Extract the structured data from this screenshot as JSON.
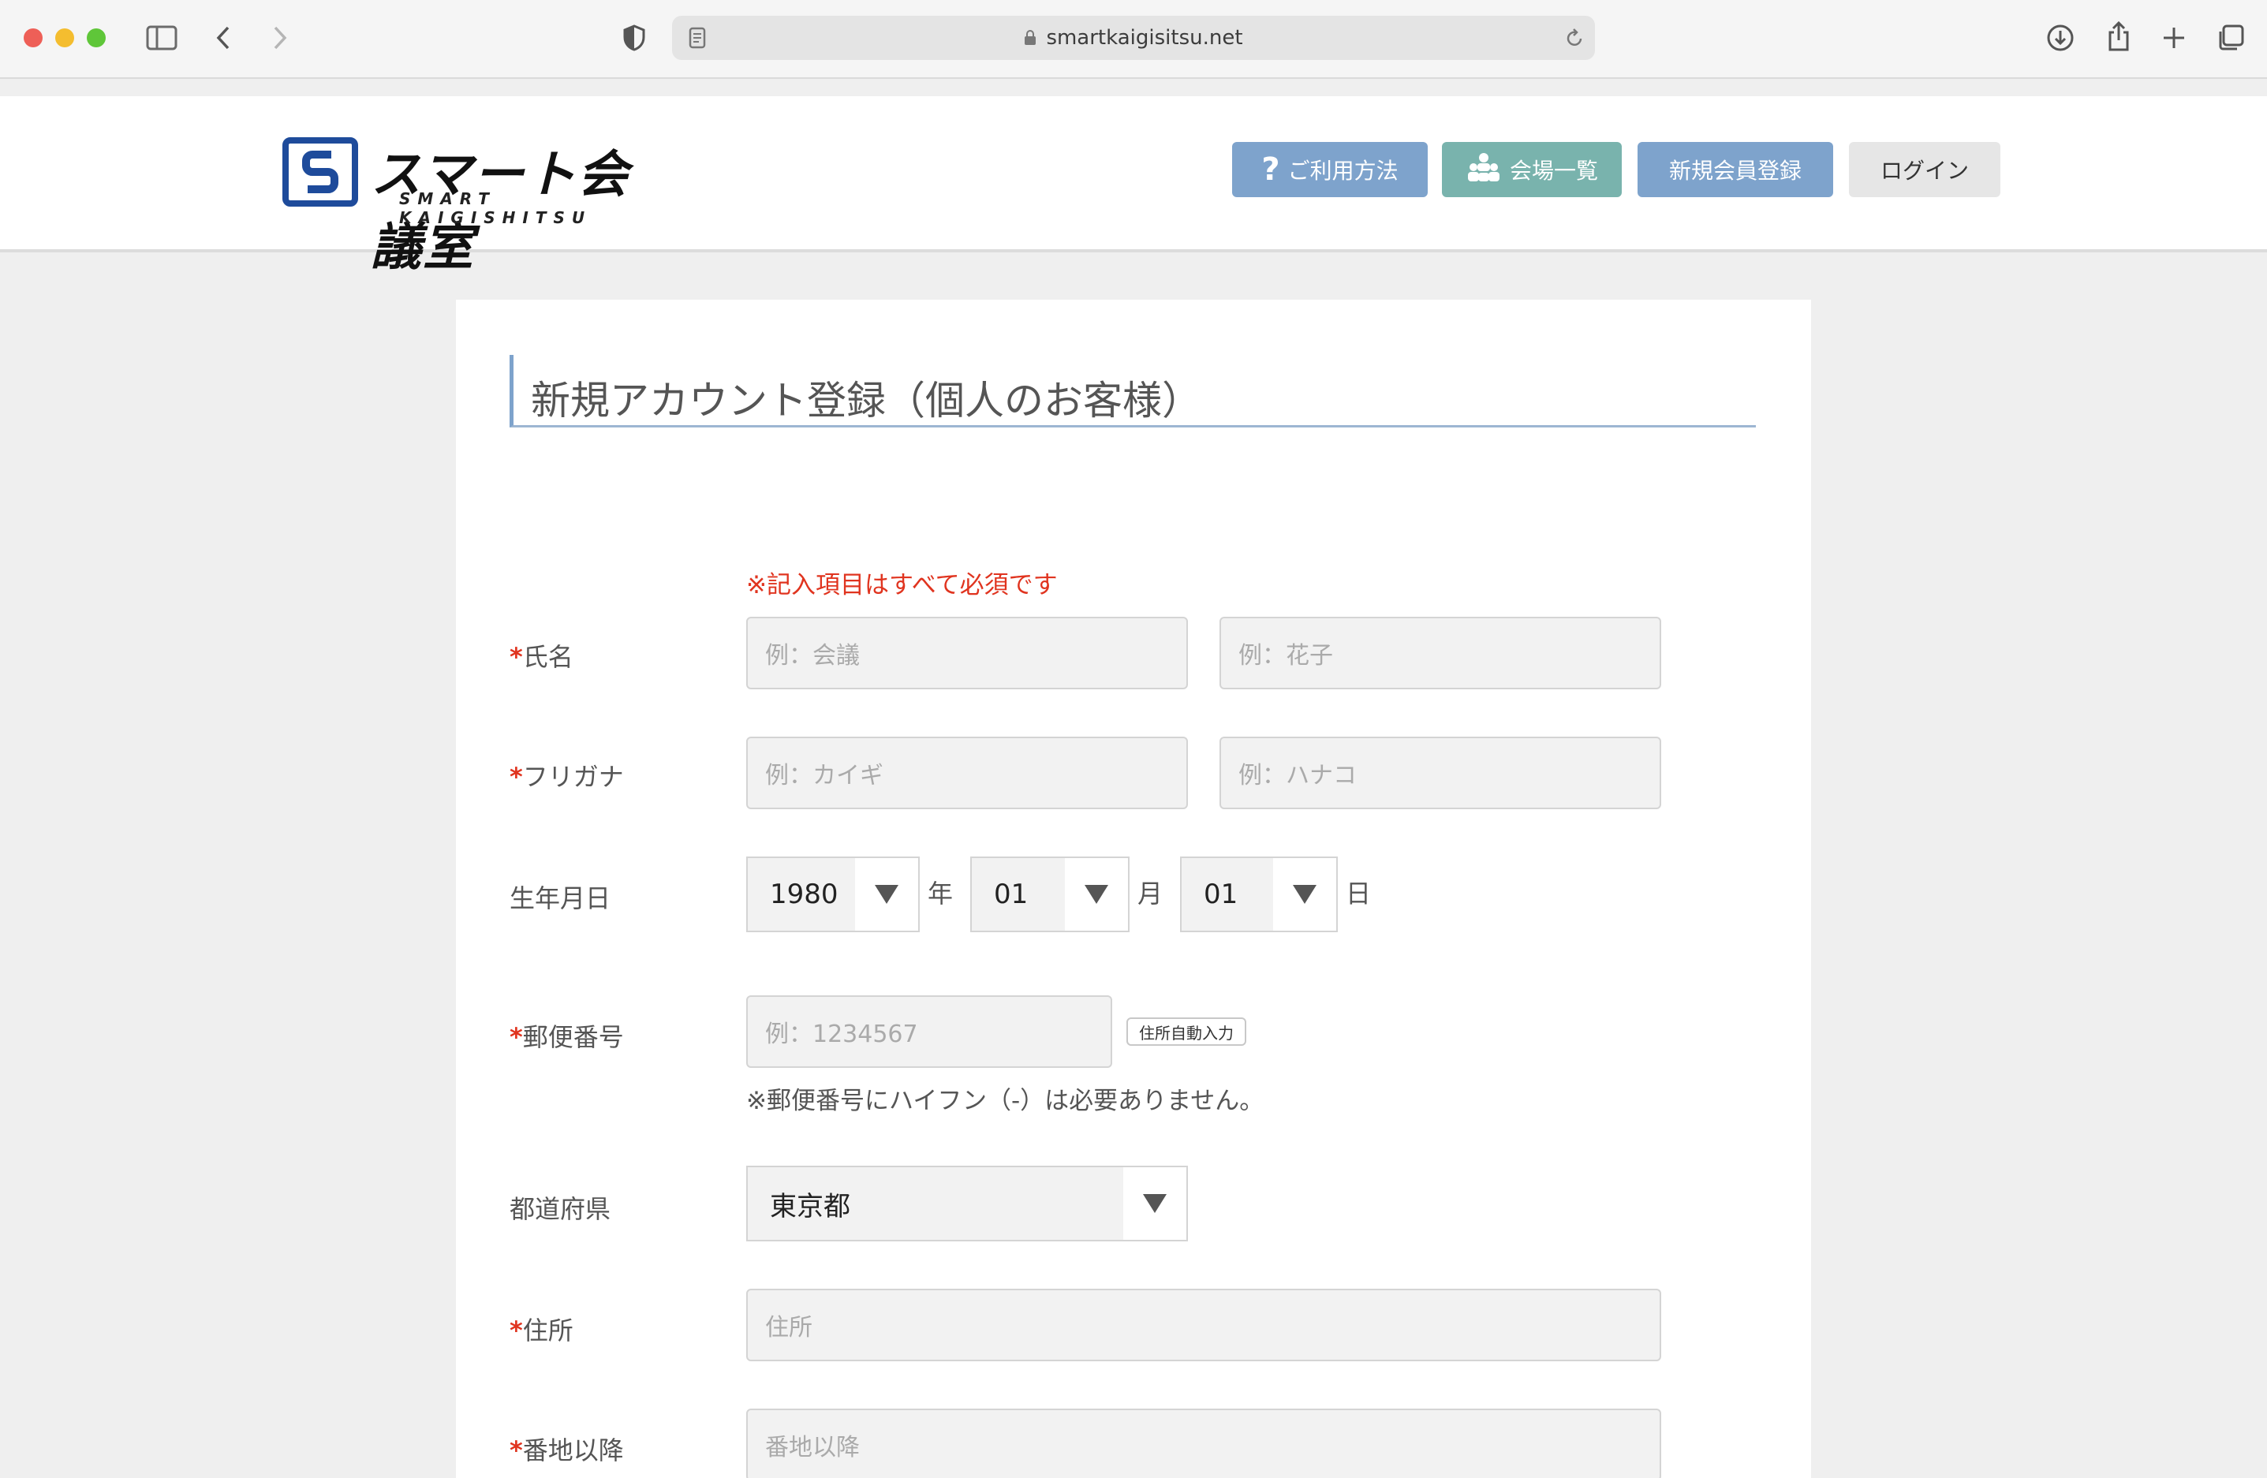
{
  "browser": {
    "url": "smartkaigisitsu.net"
  },
  "site": {
    "logo_jp": "スマート会議室",
    "logo_en": "SMART KAIGISHITSU",
    "nav": {
      "howto": "ご利用方法",
      "venues": "会場一覧",
      "register": "新規会員登録",
      "login": "ログイン"
    },
    "colors": {
      "nav_blue": "#7ea3cc",
      "nav_teal": "#79b3ad",
      "required_red": "#e0341f"
    }
  },
  "form": {
    "title": "新規アカウント登録（個人のお客様）",
    "required_note": "※記入項目はすべて必須です",
    "required_mark": "*",
    "name": {
      "label": "氏名",
      "last_placeholder": "例：会議",
      "first_placeholder": "例：花子"
    },
    "kana": {
      "label": "フリガナ",
      "last_placeholder": "例：カイギ",
      "first_placeholder": "例：ハナコ"
    },
    "birthdate": {
      "label": "生年月日",
      "year": "1980",
      "year_unit": "年",
      "month": "01",
      "month_unit": "月",
      "day": "01",
      "day_unit": "日"
    },
    "zip": {
      "label": "郵便番号",
      "placeholder": "例：1234567",
      "auto_button": "住所自動入力",
      "note": "※郵便番号にハイフン（-）は必要ありません。"
    },
    "prefecture": {
      "label": "都道府県",
      "value": "東京都"
    },
    "address": {
      "label": "住所",
      "placeholder": "住所"
    },
    "address2": {
      "label": "番地以降",
      "placeholder": "番地以降"
    }
  }
}
